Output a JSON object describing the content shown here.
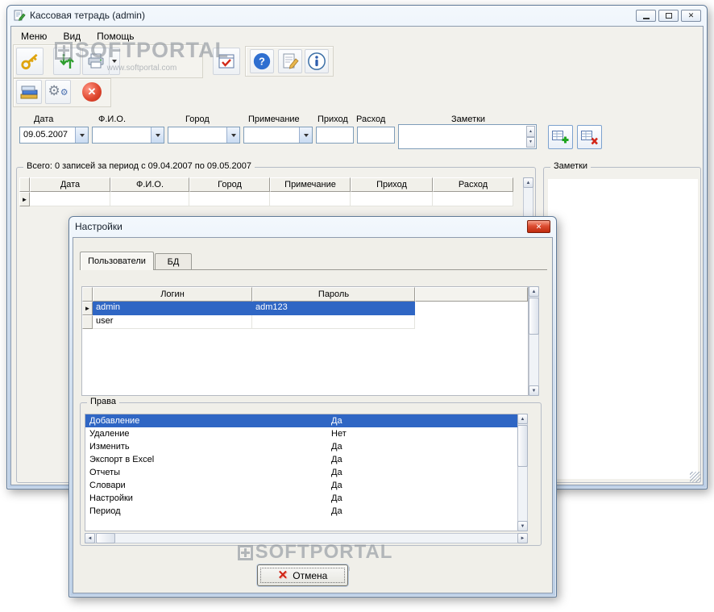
{
  "window": {
    "title": "Кассовая тетрадь (admin)",
    "menu": [
      {
        "label": "Меню"
      },
      {
        "label": "Вид"
      },
      {
        "label": "Помощь"
      }
    ]
  },
  "watermark": {
    "brand": "SOFTPORTAL",
    "url": "www.softportal.com"
  },
  "filters": {
    "date": {
      "label": "Дата",
      "value": "09.05.2007"
    },
    "fio": {
      "label": "Ф.И.О.",
      "value": ""
    },
    "city": {
      "label": "Город",
      "value": ""
    },
    "note": {
      "label": "Примечание",
      "value": ""
    },
    "income": {
      "label": "Приход",
      "value": ""
    },
    "expense": {
      "label": "Расход",
      "value": ""
    },
    "notes": {
      "label": "Заметки",
      "value": ""
    }
  },
  "records": {
    "summary": "Всего: 0 записей за период с 09.04.2007 по 09.05.2007",
    "columns": [
      "Дата",
      "Ф.И.О.",
      "Город",
      "Примечание",
      "Приход",
      "Расход"
    ]
  },
  "notes_panel": {
    "label": "Заметки",
    "value": ""
  },
  "dialog": {
    "title": "Настройки",
    "tabs": [
      {
        "label": "Пользователи"
      },
      {
        "label": "БД"
      }
    ],
    "users": {
      "columns": [
        "Логин",
        "Пароль"
      ],
      "rows": [
        {
          "login": "admin",
          "password": "adm123"
        },
        {
          "login": "user",
          "password": ""
        }
      ]
    },
    "rights": {
      "label": "Права",
      "items": [
        {
          "name": "Добавление",
          "value": "Да"
        },
        {
          "name": "Удаление",
          "value": "Нет"
        },
        {
          "name": "Изменить",
          "value": "Да"
        },
        {
          "name": "Экспорт в Excel",
          "value": "Да"
        },
        {
          "name": "Отчеты",
          "value": "Да"
        },
        {
          "name": "Словари",
          "value": "Да"
        },
        {
          "name": "Настройки",
          "value": "Да"
        },
        {
          "name": "Период",
          "value": "Да"
        }
      ]
    },
    "cancel_label": "Отмена"
  }
}
